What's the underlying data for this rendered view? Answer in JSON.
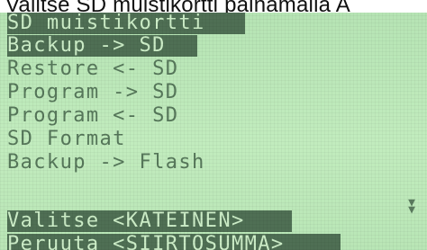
{
  "caption": "Valitse SD muistikortti painamalla A",
  "screen": {
    "title": "SD muistikortti",
    "menu_items": [
      "Backup -> SD",
      "Restore <- SD",
      "Program -> SD",
      "Program <- SD",
      "SD Format",
      "Backup -> Flash"
    ],
    "selected_index": 0,
    "scroll_indicator": "scroll-down-arrows-icon",
    "footer": {
      "select_label": "Valitse <KATEINEN>",
      "cancel_label": "Peruuta <SIIRTOSUMMA>"
    }
  },
  "colors": {
    "lcd_background": "#bfe9bb",
    "lcd_text": "#4a6a4c",
    "highlight_background": "#4f6f54",
    "highlight_text": "#cdeec8"
  }
}
